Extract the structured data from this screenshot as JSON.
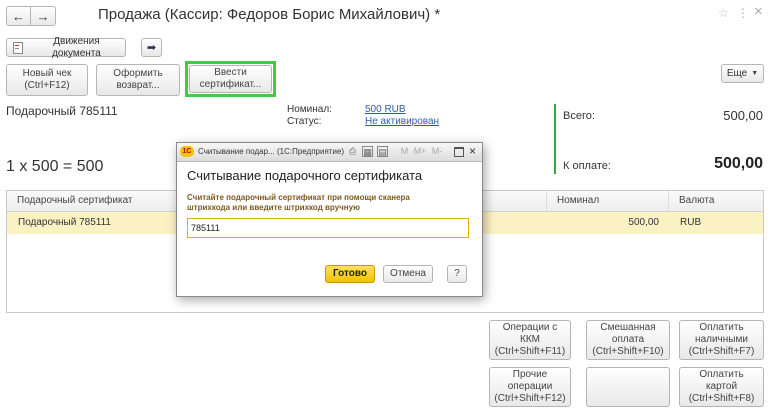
{
  "window": {
    "title": "Продажа (Кассир: Федоров Борис Михайлович) *",
    "back_icon": "←",
    "forward_icon": "→",
    "star_icon": "☆",
    "menu_icon": "⋮",
    "close_icon": "×"
  },
  "toolbar": {
    "movements_label": "Движения документа",
    "new_check": [
      "Новый чек",
      "(Ctrl+F12)"
    ],
    "make_return": [
      "Оформить",
      "возврат..."
    ],
    "enter_certificate": [
      "Ввести",
      "сертификат..."
    ],
    "more_label": "Еще",
    "highlight_color": "#3fcc3f"
  },
  "item": {
    "name": "Подарочный 785111",
    "calc": "1 x 500 = 500",
    "nominal_label": "Номинал:",
    "nominal_value": "500 RUB",
    "status_label": "Статус:",
    "status_value": "Не активирован"
  },
  "totals": {
    "total_label": "Всего:",
    "total_value": "500,00",
    "to_pay_label": "К оплате:",
    "to_pay_value": "500,00"
  },
  "table": {
    "columns": [
      "Подарочный сертификат",
      "Номинал",
      "Валюта"
    ],
    "rows": [
      {
        "certificate": "Подарочный 785111",
        "nominal": "500,00",
        "currency": "RUB"
      }
    ]
  },
  "actions": {
    "kkm_ops": [
      "Операции с",
      "ККМ",
      "(Ctrl+Shift+F11)"
    ],
    "mixed_pay": [
      "Смешанная",
      "оплата",
      "(Ctrl+Shift+F10)"
    ],
    "pay_cash": [
      "Оплатить",
      "наличными",
      "(Ctrl+Shift+F7)"
    ],
    "other_ops": [
      "Прочие",
      "операции",
      "(Ctrl+Shift+F12)"
    ],
    "pay_card": [
      "Оплатить",
      "картой",
      "(Ctrl+Shift+F8)"
    ]
  },
  "dialog": {
    "titlebar": "Считывание подар... (1С:Предприятие)",
    "logo": "1С",
    "heading": "Считывание подарочного сертификата",
    "hint_line1": "Считайте подарочный сертификат при помощи сканера",
    "hint_line2": "штрихкода или введите штрихкод вручную",
    "input_value": "785111",
    "ok_label": "Готово",
    "cancel_label": "Отмена",
    "help_label": "?",
    "tb_m": "M",
    "tb_mplus": "M+",
    "tb_mminus": "M-"
  }
}
